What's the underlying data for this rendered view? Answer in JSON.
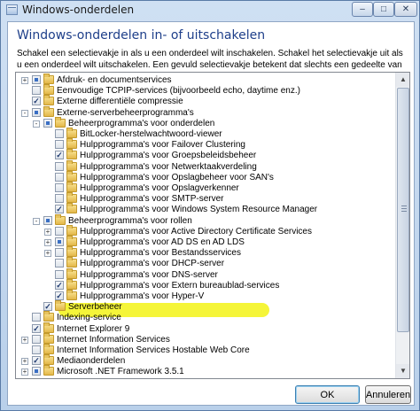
{
  "window": {
    "title": "Windows-onderdelen",
    "minimize_glyph": "–",
    "maximize_glyph": "□",
    "close_glyph": "✕"
  },
  "dialog": {
    "heading": "Windows-onderdelen in- of uitschakelen",
    "description": "Schakel een selectievakje in als u een onderdeel wilt inschakelen. Schakel het selectievakje uit als u een onderdeel wilt uitschakelen. Een gevuld selectievakje betekent dat slechts een gedeelte van het onderdeel is ingeschakeld."
  },
  "tree": {
    "items": [
      {
        "label": "Afdruk- en documentservices",
        "level": 0,
        "expander": "+",
        "state": "partial",
        "folder": true
      },
      {
        "label": "Eenvoudige TCPIP-services (bijvoorbeeld echo, daytime enz.)",
        "level": 0,
        "expander": "",
        "state": "unchecked",
        "folder": true
      },
      {
        "label": "Externe differentiële compressie",
        "level": 0,
        "expander": "",
        "state": "checked",
        "folder": true
      },
      {
        "label": "Externe-serverbeheerprogramma's",
        "level": 0,
        "expander": "-",
        "state": "partial",
        "folder": true
      },
      {
        "label": "Beheerprogramma's voor onderdelen",
        "level": 1,
        "expander": "-",
        "state": "partial",
        "folder": true
      },
      {
        "label": "BitLocker-herstelwachtwoord-viewer",
        "level": 2,
        "expander": "",
        "state": "unchecked",
        "folder": true
      },
      {
        "label": "Hulpprogramma's voor Failover Clustering",
        "level": 2,
        "expander": "",
        "state": "unchecked",
        "folder": true
      },
      {
        "label": "Hulpprogramma's voor Groepsbeleidsbeheer",
        "level": 2,
        "expander": "",
        "state": "checked",
        "folder": true
      },
      {
        "label": "Hulpprogramma's voor Netwerktaakverdeling",
        "level": 2,
        "expander": "",
        "state": "unchecked",
        "folder": true
      },
      {
        "label": "Hulpprogramma's voor Opslagbeheer voor SAN's",
        "level": 2,
        "expander": "",
        "state": "unchecked",
        "folder": true
      },
      {
        "label": "Hulpprogramma's voor Opslagverkenner",
        "level": 2,
        "expander": "",
        "state": "unchecked",
        "folder": true
      },
      {
        "label": "Hulpprogramma's voor SMTP-server",
        "level": 2,
        "expander": "",
        "state": "unchecked",
        "folder": true
      },
      {
        "label": "Hulpprogramma's voor Windows System Resource Manager",
        "level": 2,
        "expander": "",
        "state": "checked",
        "folder": true
      },
      {
        "label": "Beheerprogramma's voor rollen",
        "level": 1,
        "expander": "-",
        "state": "partial",
        "folder": true
      },
      {
        "label": "Hulpprogramma's voor Active Directory Certificate Services",
        "level": 2,
        "expander": "+",
        "state": "unchecked",
        "folder": true
      },
      {
        "label": "Hulpprogramma's voor AD DS en AD LDS",
        "level": 2,
        "expander": "+",
        "state": "partial",
        "folder": true
      },
      {
        "label": "Hulpprogramma's voor Bestandsservices",
        "level": 2,
        "expander": "+",
        "state": "unchecked",
        "folder": true
      },
      {
        "label": "Hulpprogramma's voor DHCP-server",
        "level": 2,
        "expander": "",
        "state": "unchecked",
        "folder": true
      },
      {
        "label": "Hulpprogramma's voor DNS-server",
        "level": 2,
        "expander": "",
        "state": "unchecked",
        "folder": true
      },
      {
        "label": "Hulpprogramma's voor Extern bureaublad-services",
        "level": 2,
        "expander": "",
        "state": "checked",
        "folder": true
      },
      {
        "label": "Hulpprogramma's voor Hyper-V",
        "level": 2,
        "expander": "",
        "state": "checked",
        "folder": true
      },
      {
        "label": "Serverbeheer",
        "level": 1,
        "expander": "",
        "state": "checked",
        "folder": true
      },
      {
        "label": "Indexing-service",
        "level": 0,
        "expander": "",
        "state": "unchecked",
        "folder": true
      },
      {
        "label": "Internet Explorer 9",
        "level": 0,
        "expander": "",
        "state": "checked",
        "folder": true
      },
      {
        "label": "Internet Information Services",
        "level": 0,
        "expander": "+",
        "state": "unchecked",
        "folder": true
      },
      {
        "label": "Internet Information Services Hostable Web Core",
        "level": 0,
        "expander": "",
        "state": "unchecked",
        "folder": true
      },
      {
        "label": "Mediaonderdelen",
        "level": 0,
        "expander": "+",
        "state": "checked",
        "folder": true
      },
      {
        "label": "Microsoft .NET Framework 3.5.1",
        "level": 0,
        "expander": "+",
        "state": "partial",
        "folder": true
      }
    ],
    "scroll_up_glyph": "▲",
    "scroll_down_glyph": "▼"
  },
  "buttons": {
    "ok_label": "OK",
    "cancel_label": "Annuleren"
  },
  "colors": {
    "heading": "#1e3f8a",
    "highlight": "#f5f539",
    "checkmark": "#1f3a70",
    "partial_fill": "#3a6fc4"
  }
}
